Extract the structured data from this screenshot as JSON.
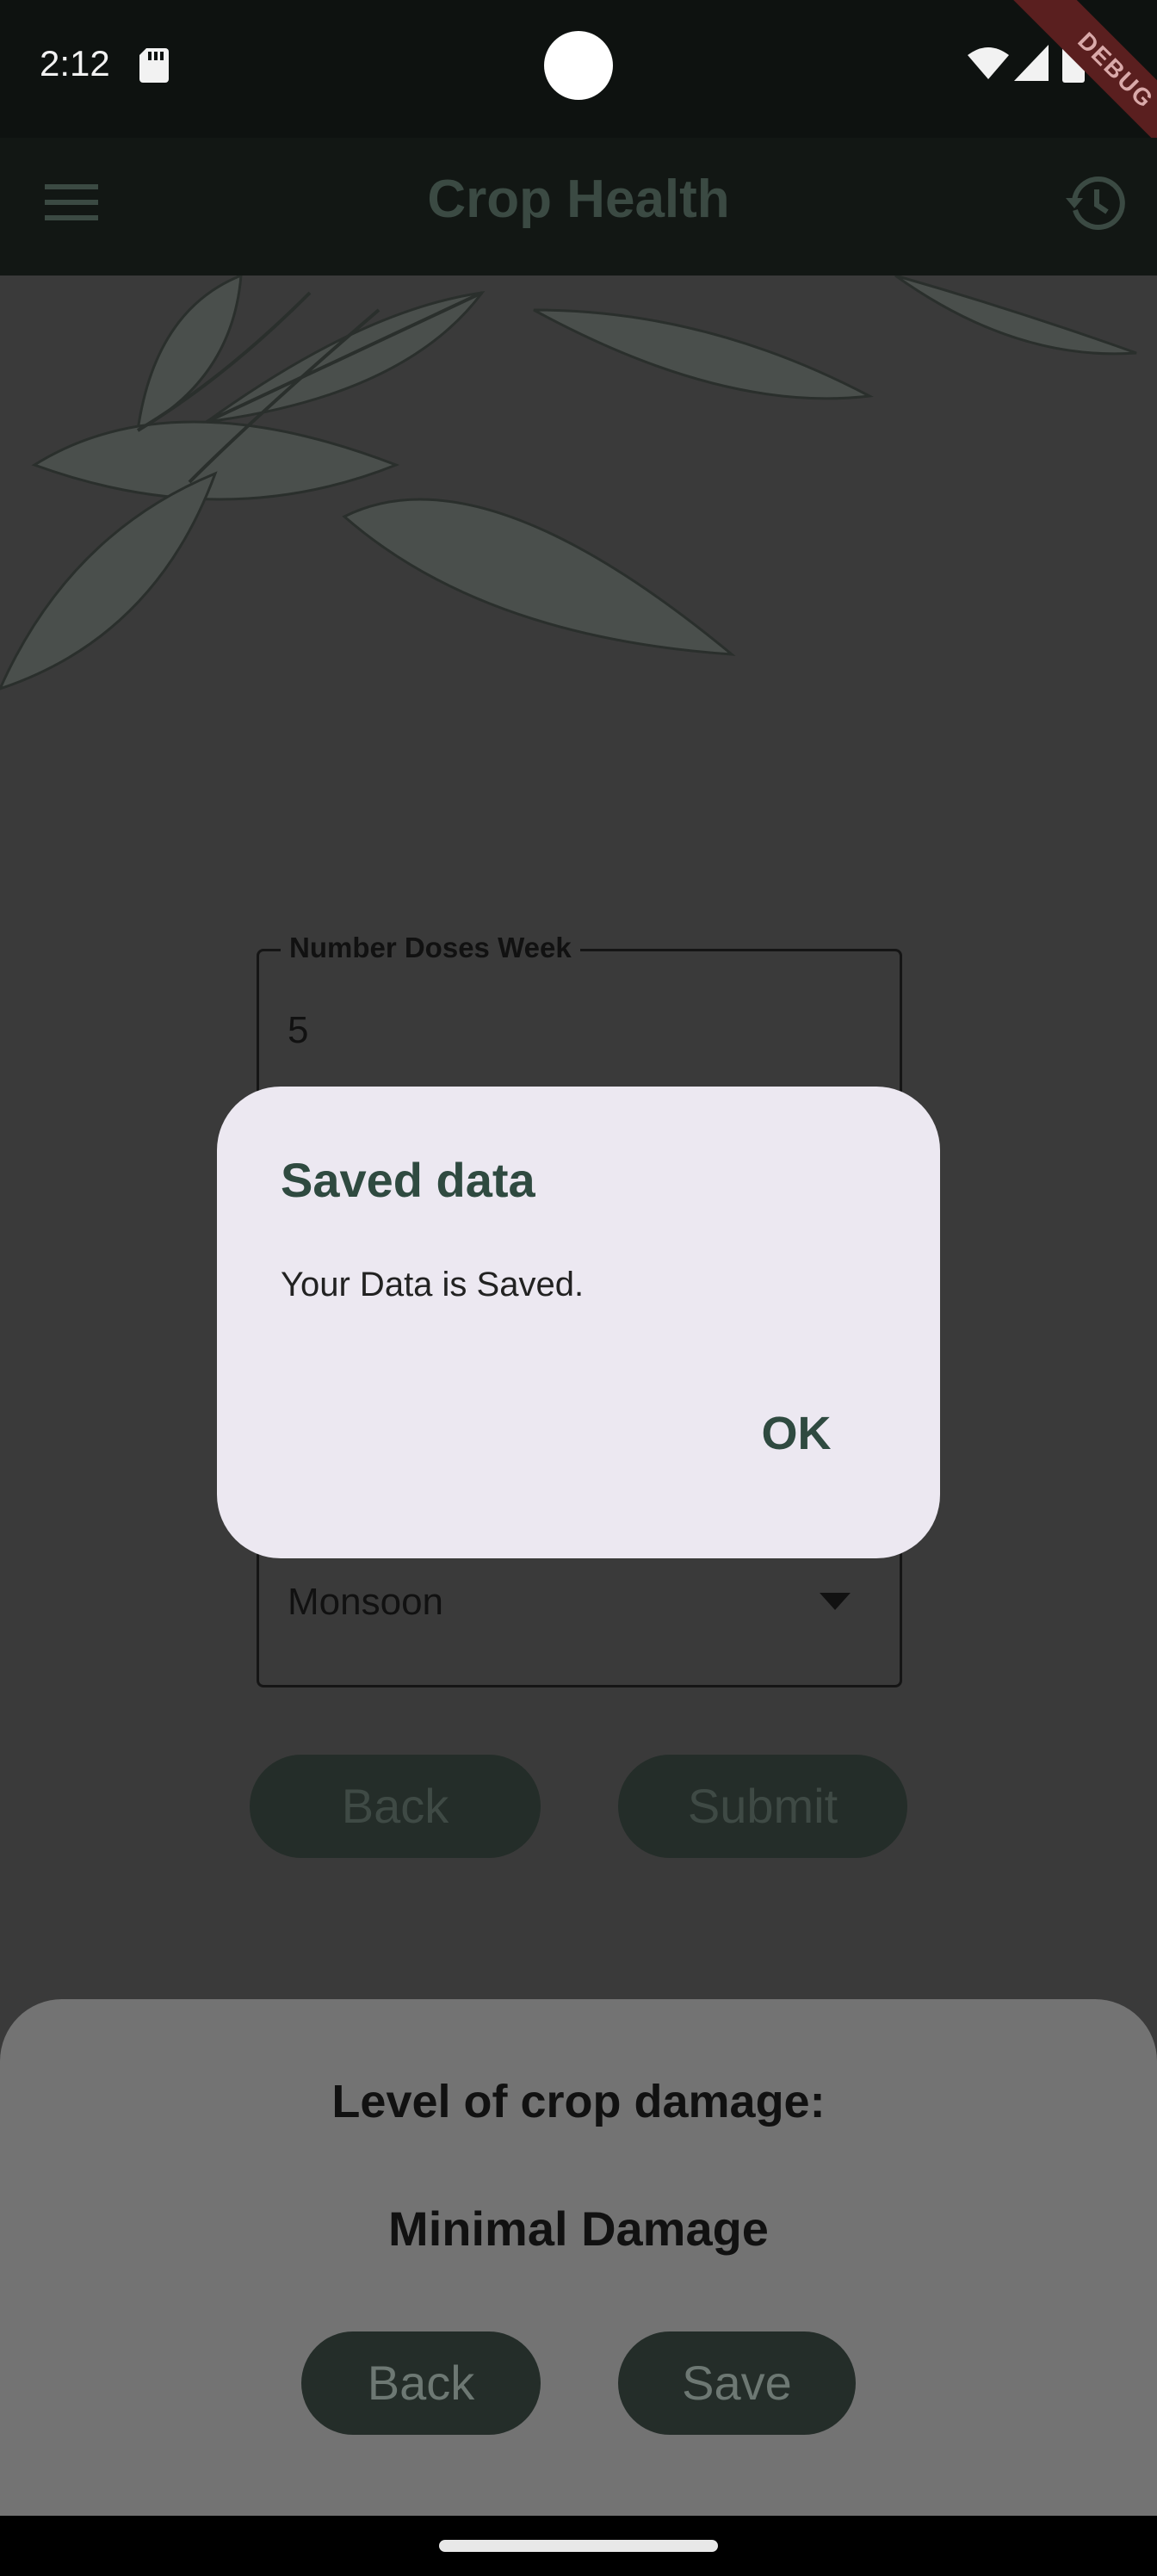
{
  "status_bar": {
    "time": "2:12",
    "icons": [
      "sd-card-icon",
      "wifi-icon",
      "signal-icon",
      "battery-icon"
    ]
  },
  "debug_banner": "DEBUG",
  "app_bar": {
    "title": "Crop Health",
    "left_icon": "menu-icon",
    "right_icon": "history-icon"
  },
  "form": {
    "doses_label": "Number Doses Week",
    "doses_value": "5",
    "season_value": "Monsoon",
    "back_label": "Back",
    "submit_label": "Submit"
  },
  "bottom_sheet": {
    "heading": "Level of crop damage:",
    "result": "Minimal Damage",
    "back_label": "Back",
    "save_label": "Save"
  },
  "dialog": {
    "title": "Saved data",
    "message": "Your Data is Saved.",
    "ok_label": "OK"
  },
  "colors": {
    "dialog_bg": "#ece8f1",
    "accent": "#2f4a40",
    "scrim": "#3a3a3a",
    "button_bg": "#242d29"
  }
}
